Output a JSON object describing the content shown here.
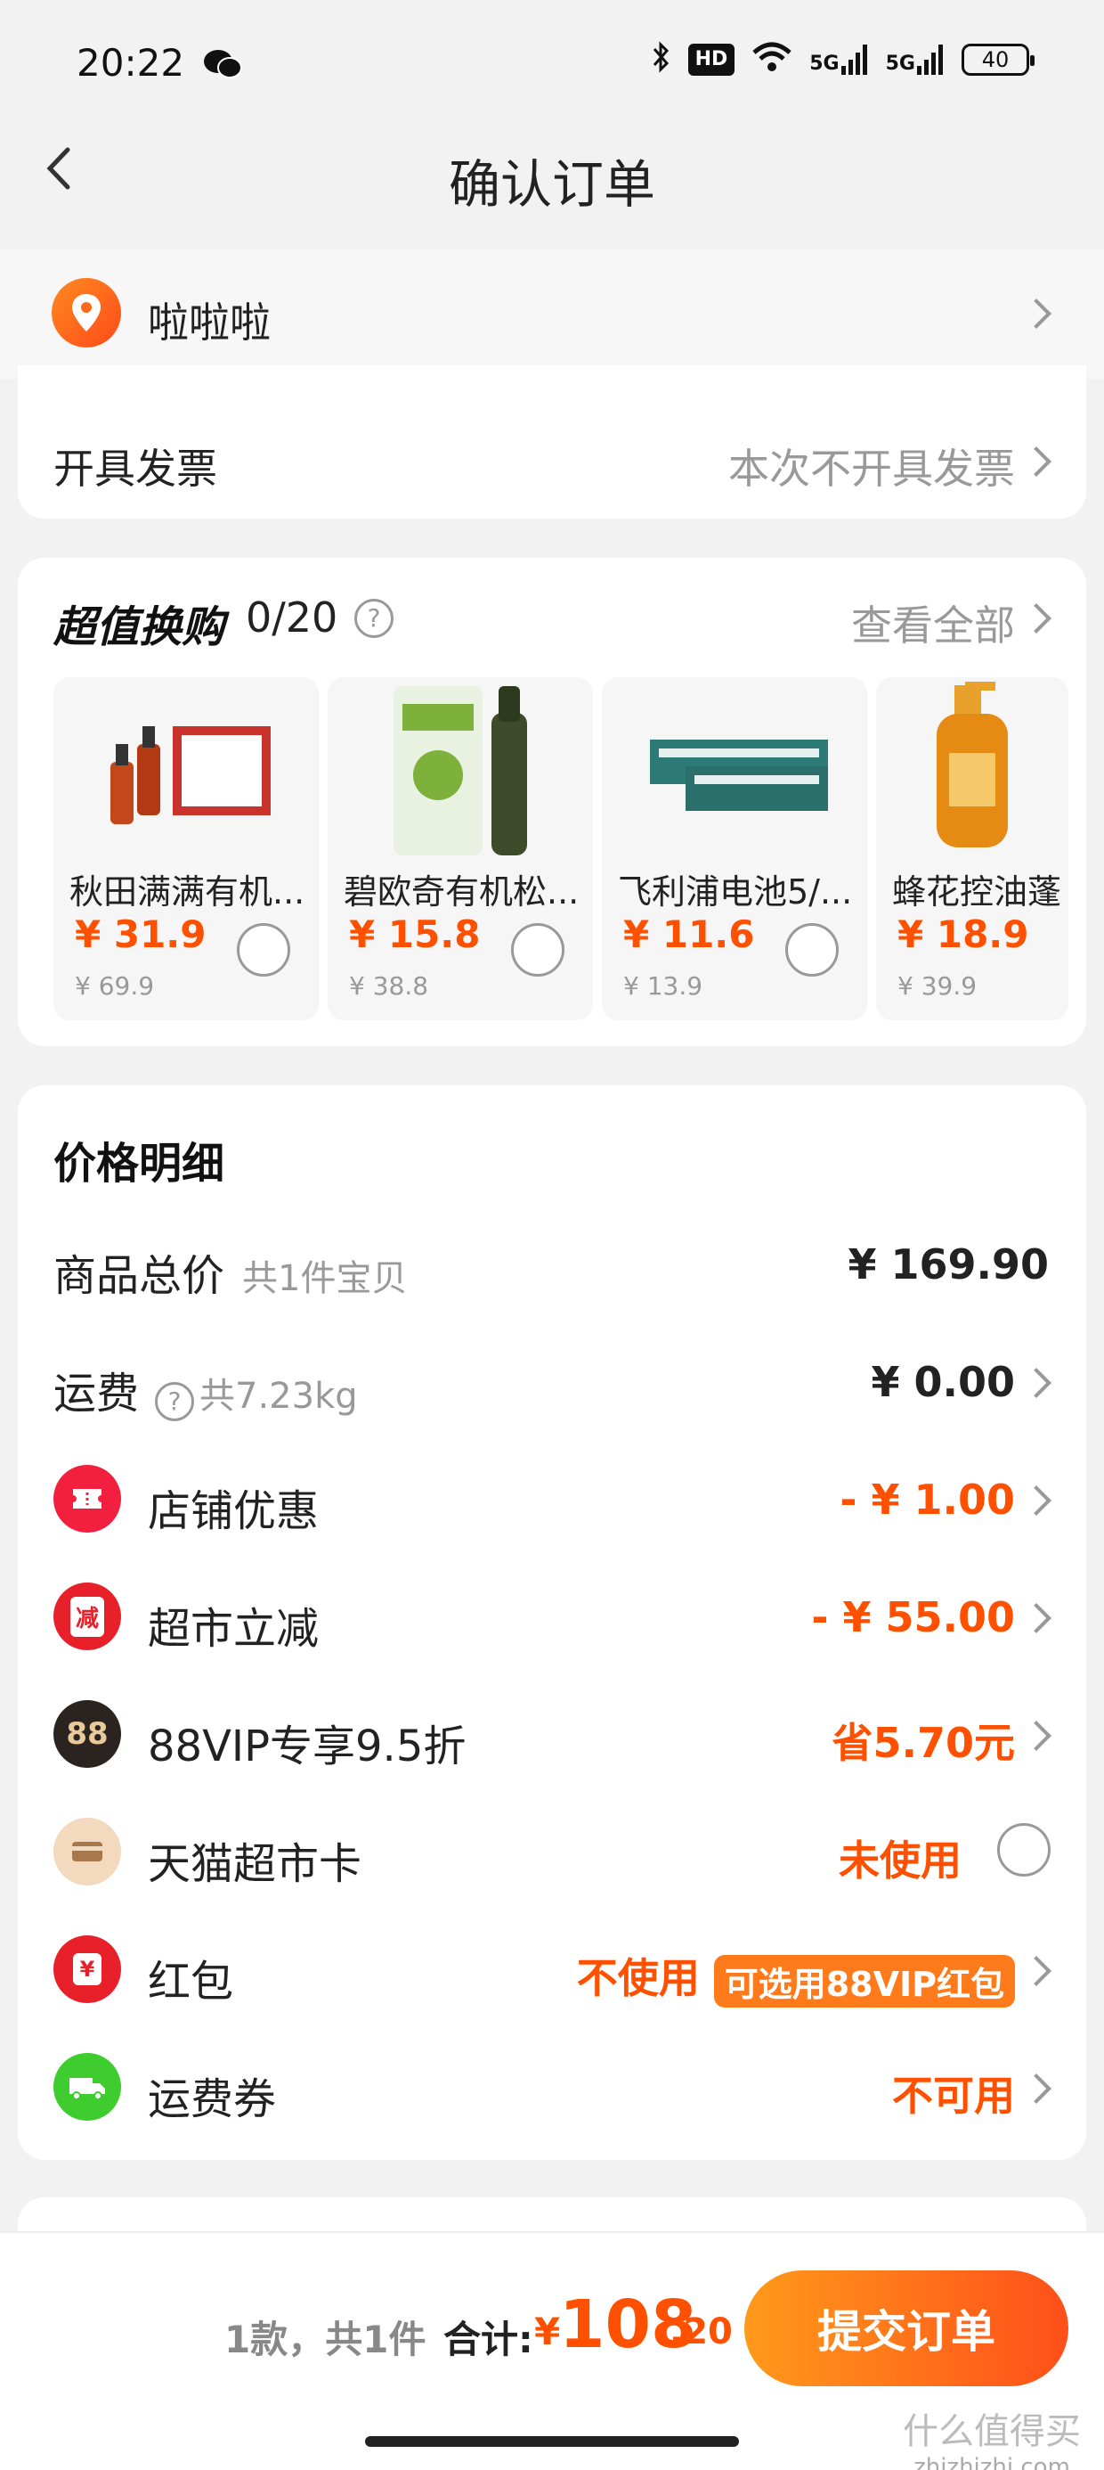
{
  "status_bar": {
    "time": "20:22",
    "hd": "HD",
    "sig1": "5G",
    "sig2": "5G",
    "battery": "40"
  },
  "nav": {
    "title": "确认订单"
  },
  "address": {
    "text": "啦啦啦"
  },
  "invoice": {
    "label": "开具发票",
    "value": "本次不开具发票"
  },
  "deals": {
    "title": "超值换购",
    "count": "0/20",
    "view_all": "查看全部",
    "items": [
      {
        "name": "秋田满满有机...",
        "price": "¥ 31.9",
        "original": "¥ 69.9"
      },
      {
        "name": "碧欧奇有机松...",
        "price": "¥ 15.8",
        "original": "¥ 38.8"
      },
      {
        "name": "飞利浦电池5/...",
        "price": "¥ 11.6",
        "original": "¥ 13.9"
      },
      {
        "name": "蜂花控油蓬",
        "price": "¥ 18.9",
        "original": "¥ 39.9"
      }
    ]
  },
  "price": {
    "title": "价格明细",
    "rows": [
      {
        "label": "商品总价",
        "sub": "共1件宝贝",
        "value": "¥ 169.90"
      },
      {
        "label": "运费",
        "sub": "共7.23kg",
        "value": "¥ 0.00"
      },
      {
        "label": "店铺优惠",
        "value": "- ¥ 1.00",
        "icon_text": ""
      },
      {
        "label": "超市立减",
        "value": "- ¥ 55.00",
        "icon_text": "减"
      },
      {
        "label": "88VIP专享9.5折",
        "value": "省5.70元",
        "icon_text": "88"
      },
      {
        "label": "天猫超市卡",
        "value": "未使用"
      },
      {
        "label": "红包",
        "value": "不使用",
        "tag": "可选用88VIP红包",
        "icon_text": "¥"
      },
      {
        "label": "运费券",
        "value": "不可用"
      }
    ]
  },
  "footer": {
    "count": "1款，共1件",
    "total_label": "合计:",
    "yen": "¥",
    "total_int": "108",
    "total_dec": ".20",
    "submit": "提交订单"
  },
  "watermark": "什么值得买",
  "watermark_url": "zhizhizhi.com",
  "colors": {
    "accent": "#ff5000",
    "submit_start": "#ff9a1a",
    "submit_end": "#ff4f1a"
  }
}
